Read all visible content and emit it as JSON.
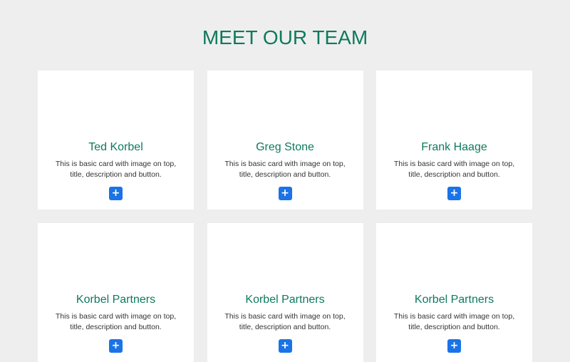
{
  "page": {
    "title": "MEET OUR TEAM"
  },
  "cards": [
    {
      "name": "Ted Korbel",
      "description": "This is basic card with image on top, title, description and button.",
      "button_label": "+"
    },
    {
      "name": "Greg Stone",
      "description": "This is basic card with image on top, title, description and button.",
      "button_label": "+"
    },
    {
      "name": "Frank Haage",
      "description": "This is basic card with image on top, title, description and button.",
      "button_label": "+"
    },
    {
      "name": "Korbel Partners",
      "description": "This is basic card with image on top, title, description and button.",
      "button_label": "+"
    },
    {
      "name": "Korbel Partners",
      "description": "This is basic card with image on top, title, description and button.",
      "button_label": "+"
    },
    {
      "name": "Korbel Partners",
      "description": "This is basic card with image on top, title, description and button.",
      "button_label": "+"
    }
  ],
  "colors": {
    "background": "#eeeeee",
    "accent": "#0e7a5c",
    "button": "#1a73e8",
    "card": "#ffffff"
  },
  "icons": {
    "card_button": "plus-icon"
  }
}
